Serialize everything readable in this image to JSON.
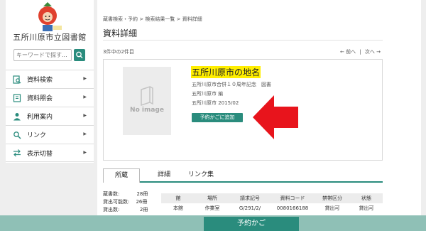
{
  "sidebar": {
    "library_name": "五所川原市立図書館",
    "search": {
      "placeholder": "キーワードで探す..."
    },
    "nav": [
      {
        "label": "資料検索",
        "icon": "search-book-icon"
      },
      {
        "label": "資料照会",
        "icon": "book-icon"
      },
      {
        "label": "利用案内",
        "icon": "user-icon"
      },
      {
        "label": "リンク",
        "icon": "link-search-icon"
      },
      {
        "label": "表示切替",
        "icon": "switch-icon"
      }
    ]
  },
  "breadcrumb": "蔵書検索・予約 > 検索結果一覧 > 資料詳細",
  "page_title": "資料詳細",
  "result_count": "3件中の2件目",
  "pager": {
    "prev": "← 前へ",
    "separator": "|",
    "next": "次へ →"
  },
  "item": {
    "no_image": "No image",
    "title": "五所川原市の地名",
    "subtitle": "五所川原市合併１０周年記念　図書",
    "author": "五所川原市 編",
    "publisher": "五所川原市  2015/02",
    "add_to_cart": "予約かごに追加"
  },
  "tabs": [
    "所蔵",
    "詳細",
    "リンク集"
  ],
  "stats": [
    {
      "label": "蔵書数:",
      "value": "28冊"
    },
    {
      "label": "貸出可能数:",
      "value": "26冊"
    },
    {
      "label": "貸出数:",
      "value": "2冊"
    }
  ],
  "holdings": {
    "headers": [
      "館",
      "場所",
      "請求記号",
      "資料コード",
      "禁帯区分",
      "状態"
    ],
    "rows": [
      [
        "本館",
        "作業室",
        "G/291/2/",
        "0080166188",
        "貸出可",
        "貸出可"
      ]
    ]
  },
  "cart_button": "予約かご",
  "colors": {
    "accent": "#2a8c7d",
    "highlight": "#ffee00",
    "arrow": "#e8141c"
  }
}
